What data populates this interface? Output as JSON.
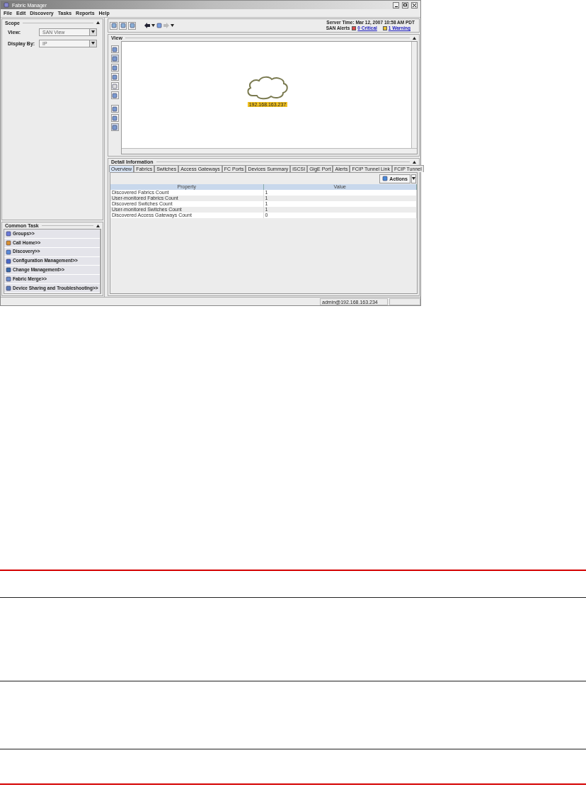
{
  "window": {
    "title": "Fabric Manager"
  },
  "menu": [
    "File",
    "Edit",
    "Discovery",
    "Tasks",
    "Reports",
    "Help"
  ],
  "scope": {
    "title": "Scope",
    "fields": [
      {
        "label": "View:",
        "value": "SAN View"
      },
      {
        "label": "Display By:",
        "value": "IP"
      }
    ]
  },
  "common_task": {
    "title": "Common Task",
    "items": [
      "Groups>>",
      "Call Home>>",
      "Discovery>>",
      "Configuration Management>>",
      "Change Management>>",
      "Fabric Merge>>",
      "Device Sharing and Troubleshooting>>"
    ]
  },
  "header": {
    "server_time": "Server Time: Mar 12, 2007 10:58 AM PDT",
    "alerts_label": "SAN Alerts",
    "alerts": [
      {
        "text": "0 Critical",
        "color": "#e04848"
      },
      {
        "text": "1 Warning",
        "color": "#e8c030"
      }
    ]
  },
  "view": {
    "title": "View",
    "node_label": "192.168.163.237"
  },
  "detail": {
    "title": "Detail Information",
    "tabs": [
      {
        "label": "Overview",
        "selected": true
      },
      {
        "label": "Fabrics",
        "selected": false
      },
      {
        "label": "Switches",
        "selected": false
      },
      {
        "label": "Access Gateways",
        "selected": false
      },
      {
        "label": "FC Ports",
        "selected": false
      },
      {
        "label": "Devices Summary",
        "selected": false
      },
      {
        "label": "iSCSI",
        "selected": false
      },
      {
        "label": "GigE Port",
        "selected": false
      },
      {
        "label": "Alerts",
        "selected": false
      },
      {
        "label": "FCIP Tunnel Link",
        "selected": false
      },
      {
        "label": "FCIP Tunnel",
        "selected": false
      }
    ],
    "actions": "Actions",
    "table": {
      "columns": [
        "Property",
        "Value"
      ],
      "rows": [
        [
          "Discovered Fabrics Count",
          "1"
        ],
        [
          "User-monitored Fabrics Count",
          "1"
        ],
        [
          "Discovered Switches Count",
          "1"
        ],
        [
          "User-monitored Switches Count",
          "1"
        ],
        [
          "Discovered Access Gateways Count",
          "0"
        ]
      ]
    }
  },
  "status_bar": {
    "user": "admin@192.168.163.234"
  }
}
